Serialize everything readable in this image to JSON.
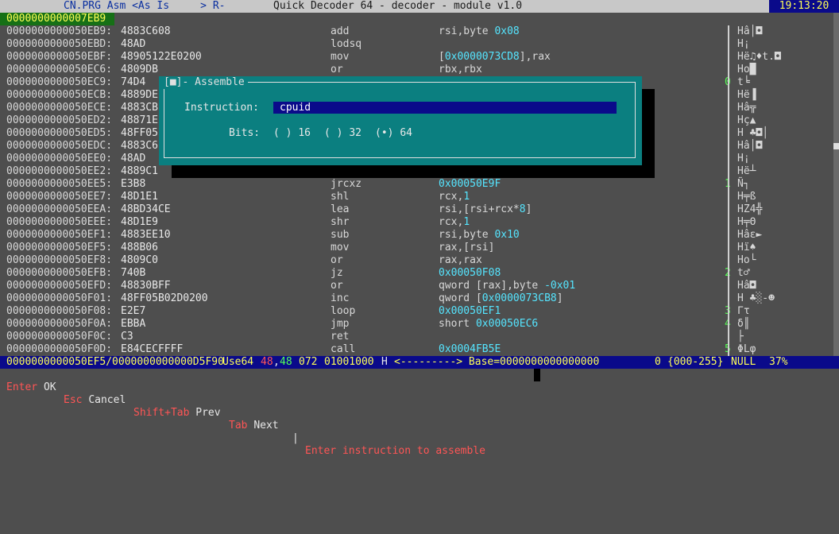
{
  "topbar": {
    "menu": "CN.PRG Asm <As Is     > R-",
    "title": "Quick Decoder 64 - decoder - module v1.0",
    "time": "19:13:20"
  },
  "header_address": "0000000000007EB9",
  "rows": [
    {
      "addr": "0000000000050EB9:",
      "hex": "4883C608",
      "mn": "add",
      "op": "rsi,byte ",
      "opx": "0x08",
      "opy": "",
      "num": "",
      "chars": "Hâ│◘"
    },
    {
      "addr": "0000000000050EBD:",
      "hex": "48AD",
      "mn": "lodsq",
      "op": "",
      "opx": "",
      "opy": "",
      "num": "",
      "chars": "H¡"
    },
    {
      "addr": "0000000000050EBF:",
      "hex": "48905122E0200",
      "mn": "mov",
      "op": "[",
      "opx": "0x0000073CD8",
      "opy": "],rax",
      "num": "",
      "chars": "Hë♫♦t.◘"
    },
    {
      "addr": "0000000000050EC6:",
      "hex": "4809DB",
      "mn": "or",
      "op": "rbx,rbx",
      "opx": "",
      "opy": "",
      "num": "",
      "chars": "Ho█"
    },
    {
      "addr": "0000000000050EC9:",
      "hex": "74D4",
      "mn": "",
      "op": "",
      "opx": "",
      "opy": "",
      "num": "0",
      "chars": "t╘"
    },
    {
      "addr": "0000000000050ECB:",
      "hex": "4889DE",
      "mn": "",
      "op": "",
      "opx": "",
      "opy": "",
      "num": "",
      "chars": "Hë▐"
    },
    {
      "addr": "0000000000050ECE:",
      "hex": "4883CB",
      "mn": "",
      "op": "",
      "opx": "",
      "opy": "",
      "num": "",
      "chars": "Hâ╦"
    },
    {
      "addr": "0000000000050ED2:",
      "hex": "48871E",
      "mn": "",
      "op": "",
      "opx": "",
      "opy": "",
      "num": "",
      "chars": "Hç▲"
    },
    {
      "addr": "0000000000050ED5:",
      "hex": "48FF05",
      "mn": "",
      "op": "",
      "opx": "",
      "opy": "",
      "num": "",
      "chars": "H ♣◘│"
    },
    {
      "addr": "0000000000050EDC:",
      "hex": "4883C6",
      "mn": "",
      "op": "",
      "opx": "",
      "opy": "",
      "num": "",
      "chars": "Hâ│◘"
    },
    {
      "addr": "0000000000050EE0:",
      "hex": "48AD",
      "mn": "",
      "op": "",
      "opx": "",
      "opy": "",
      "num": "",
      "chars": "H¡"
    },
    {
      "addr": "0000000000050EE2:",
      "hex": "4889C1",
      "mn": "mov",
      "op": "rcx,rax",
      "opx": "",
      "opy": "",
      "num": "",
      "chars": "Hë┴"
    },
    {
      "addr": "0000000000050EE5:",
      "hex": "E3B8",
      "mn": "jrcxz",
      "op": "",
      "opx": "0x00050E9F",
      "opy": "",
      "num": "1",
      "chars": "Ñ┐"
    },
    {
      "addr": "0000000000050EE7:",
      "hex": "48D1E1",
      "mn": "shl",
      "op": "rcx,",
      "opx": "1",
      "opy": "",
      "num": "",
      "chars": "H╤ß"
    },
    {
      "addr": "0000000000050EEA:",
      "hex": "48BD34CE",
      "mn": "lea",
      "op": "rsi,[rsi+rcx*",
      "opx": "8",
      "opy": "]",
      "num": "",
      "chars": "HZ4╬"
    },
    {
      "addr": "0000000000050EEE:",
      "hex": "48D1E9",
      "mn": "shr",
      "op": "rcx,",
      "opx": "1",
      "opy": "",
      "num": "",
      "chars": "H╤Θ"
    },
    {
      "addr": "0000000000050EF1:",
      "hex": "4883EE10",
      "mn": "sub",
      "op": "rsi,byte ",
      "opx": "0x10",
      "opy": "",
      "num": "",
      "chars": "Hâε►"
    },
    {
      "addr": "0000000000050EF5:",
      "hex": "488B06",
      "mn": "mov",
      "op": "rax,[rsi]",
      "opx": "",
      "opy": "",
      "num": "",
      "chars": "Hï♠"
    },
    {
      "addr": "0000000000050EF8:",
      "hex": "4809C0",
      "mn": "or",
      "op": "rax,rax",
      "opx": "",
      "opy": "",
      "num": "",
      "chars": "Ho└"
    },
    {
      "addr": "0000000000050EFB:",
      "hex": "740B",
      "mn": "jz",
      "op": "",
      "opx": "0x00050F08",
      "opy": "",
      "num": "2",
      "chars": "t♂"
    },
    {
      "addr": "0000000000050EFD:",
      "hex": "48830BFF",
      "mn": "or",
      "op": "qword [rax],byte ",
      "opx": "-0x01",
      "opy": "",
      "num": "",
      "chars": "Hâ◘"
    },
    {
      "addr": "0000000000050F01:",
      "hex": "48FF05B02D0200",
      "mn": "inc",
      "op": "qword [",
      "opx": "0x0000073CB8",
      "opy": "]",
      "num": "",
      "chars": "H ♣░-☻"
    },
    {
      "addr": "0000000000050F08:",
      "hex": "E2E7",
      "mn": "loop",
      "op": "",
      "opx": "0x00050EF1",
      "opy": "",
      "num": "3",
      "chars": "Γτ"
    },
    {
      "addr": "0000000000050F0A:",
      "hex": "EBBA",
      "mn": "jmp",
      "op": "short ",
      "opx": "0x00050EC6",
      "opy": "",
      "num": "4",
      "chars": "δ║"
    },
    {
      "addr": "0000000000050F0C:",
      "hex": "C3",
      "mn": "ret",
      "op": "",
      "opx": "",
      "opy": "",
      "num": "",
      "chars": "├"
    },
    {
      "addr": "0000000000050F0D:",
      "hex": "E84CECFFFF",
      "mn": "call",
      "op": "",
      "opx": "0x0004FB5E",
      "opy": "",
      "num": "5",
      "chars": "ΦLφ"
    }
  ],
  "dialog": {
    "title": "[■]- Assemble",
    "instruction_label": "Instruction:",
    "instruction_value": "cpuid",
    "bits_label": "Bits:",
    "options": [
      {
        "mark": "( )",
        "label": "16",
        "selected": false
      },
      {
        "mark": "( )",
        "label": "32",
        "selected": false
      },
      {
        "mark": "(•)",
        "label": "64",
        "selected": true
      }
    ]
  },
  "status": {
    "addr_range": "0000000000050EF5/0000000000000D5F90",
    "mode": "Use64",
    "val_a": "48",
    "val_b": "48",
    "octal": "072",
    "binary": "01001000",
    "char": "H",
    "base": "<---------> Base=0000000000000000",
    "num": "0",
    "range": "{000-255}",
    "null_label": "NULL",
    "pct": "37%"
  },
  "hints": {
    "k1": "Enter",
    "t1": "OK",
    "k2": "Esc",
    "t2": "Cancel",
    "k3": "Shift+Tab",
    "t3": "Prev",
    "k4": "Tab",
    "t4": "Next",
    "sep": "|",
    "msg": "Enter instruction to assemble"
  }
}
